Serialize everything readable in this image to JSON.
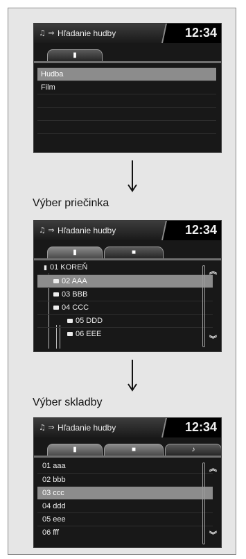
{
  "header": {
    "title": "Hľadanie hudby",
    "clock": "12:34",
    "source_icon_glyph": "♫ ⇒",
    "source_icon_name": "music-source-icon"
  },
  "icons": {
    "usb": "▮",
    "folder": "■",
    "music_note": "♪",
    "scroll_up": "︽",
    "scroll_down": "︾"
  },
  "screen1": {
    "tabs": [
      {
        "name": "usb-tab",
        "glyph": "▮"
      }
    ],
    "items": [
      "Hudba",
      "Film",
      "",
      "",
      "",
      ""
    ],
    "selected_index": 0
  },
  "caption_folder": "Výber priečinka",
  "screen2": {
    "tabs": [
      {
        "name": "usb-tab",
        "glyph": "▮"
      },
      {
        "name": "folder-tab",
        "glyph": "■"
      }
    ],
    "items": [
      {
        "label": "01 KOREŇ",
        "icon": "usb",
        "level": 0
      },
      {
        "label": "02 AAA",
        "icon": "folder",
        "level": 1
      },
      {
        "label": "03 BBB",
        "icon": "folder",
        "level": 1
      },
      {
        "label": "04 CCC",
        "icon": "folder",
        "level": 1
      },
      {
        "label": "05 DDD",
        "icon": "folder",
        "level": 2
      },
      {
        "label": "06 EEE",
        "icon": "folder",
        "level": 2
      }
    ],
    "selected_index": 1
  },
  "caption_track": "Výber skladby",
  "screen3": {
    "tabs": [
      {
        "name": "usb-tab",
        "glyph": "▮"
      },
      {
        "name": "folder-tab",
        "glyph": "■"
      },
      {
        "name": "music-tab",
        "glyph": "♪"
      }
    ],
    "items": [
      "01 aaa",
      "02 bbb",
      "03 ccc",
      "04 ddd",
      "05 eee",
      "06 fff"
    ],
    "selected_index": 2
  }
}
